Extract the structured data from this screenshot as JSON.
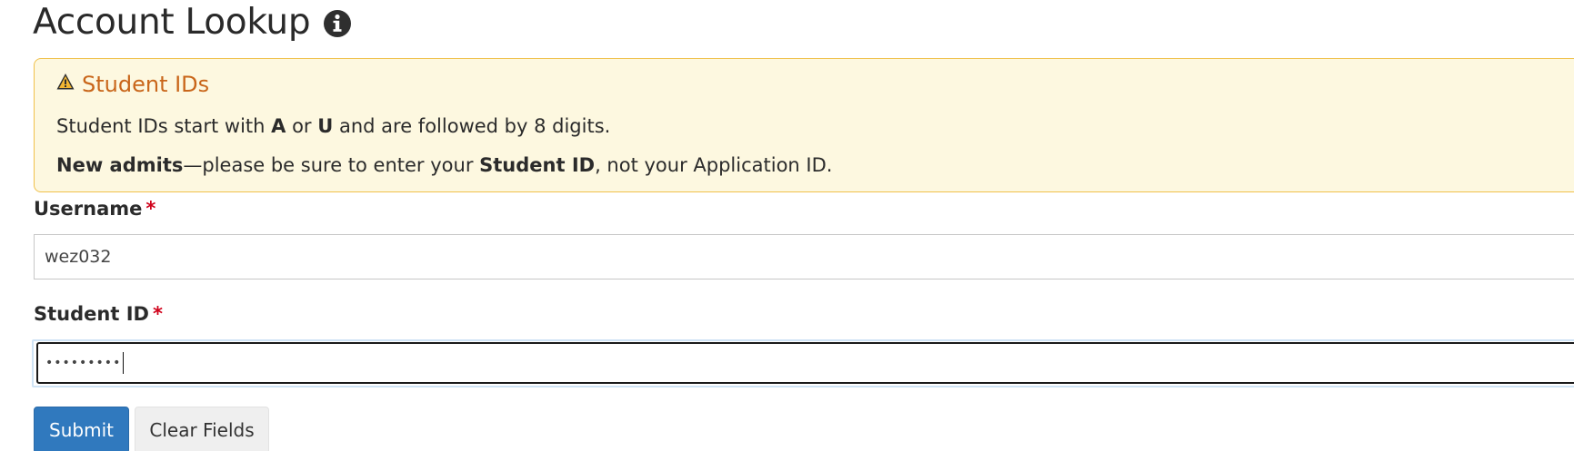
{
  "page": {
    "title": "Account Lookup",
    "title_icon": "info-circle-icon"
  },
  "alert": {
    "icon": "warning-triangle-icon",
    "title": "Student IDs",
    "line1": {
      "pre": "Student IDs start with ",
      "b1": "A",
      "mid": " or ",
      "b2": "U",
      "post": " and are followed by 8 digits."
    },
    "line2": {
      "b1": "New admits",
      "mid": "—please be sure to enter your ",
      "b2": "Student ID",
      "post": ", not your Application ID."
    },
    "colors": {
      "background": "#fdf8e0",
      "border": "#f0c14b",
      "title": "#c9661a"
    }
  },
  "form": {
    "username": {
      "label": "Username",
      "required_mark": "*",
      "value": "wez032"
    },
    "student_id": {
      "label": "Student ID",
      "required_mark": "*",
      "masked_value": "•••••••••"
    },
    "buttons": {
      "submit": "Submit",
      "clear": "Clear Fields"
    }
  },
  "colors": {
    "primary_button": "#3079be",
    "required": "#d0021b"
  }
}
